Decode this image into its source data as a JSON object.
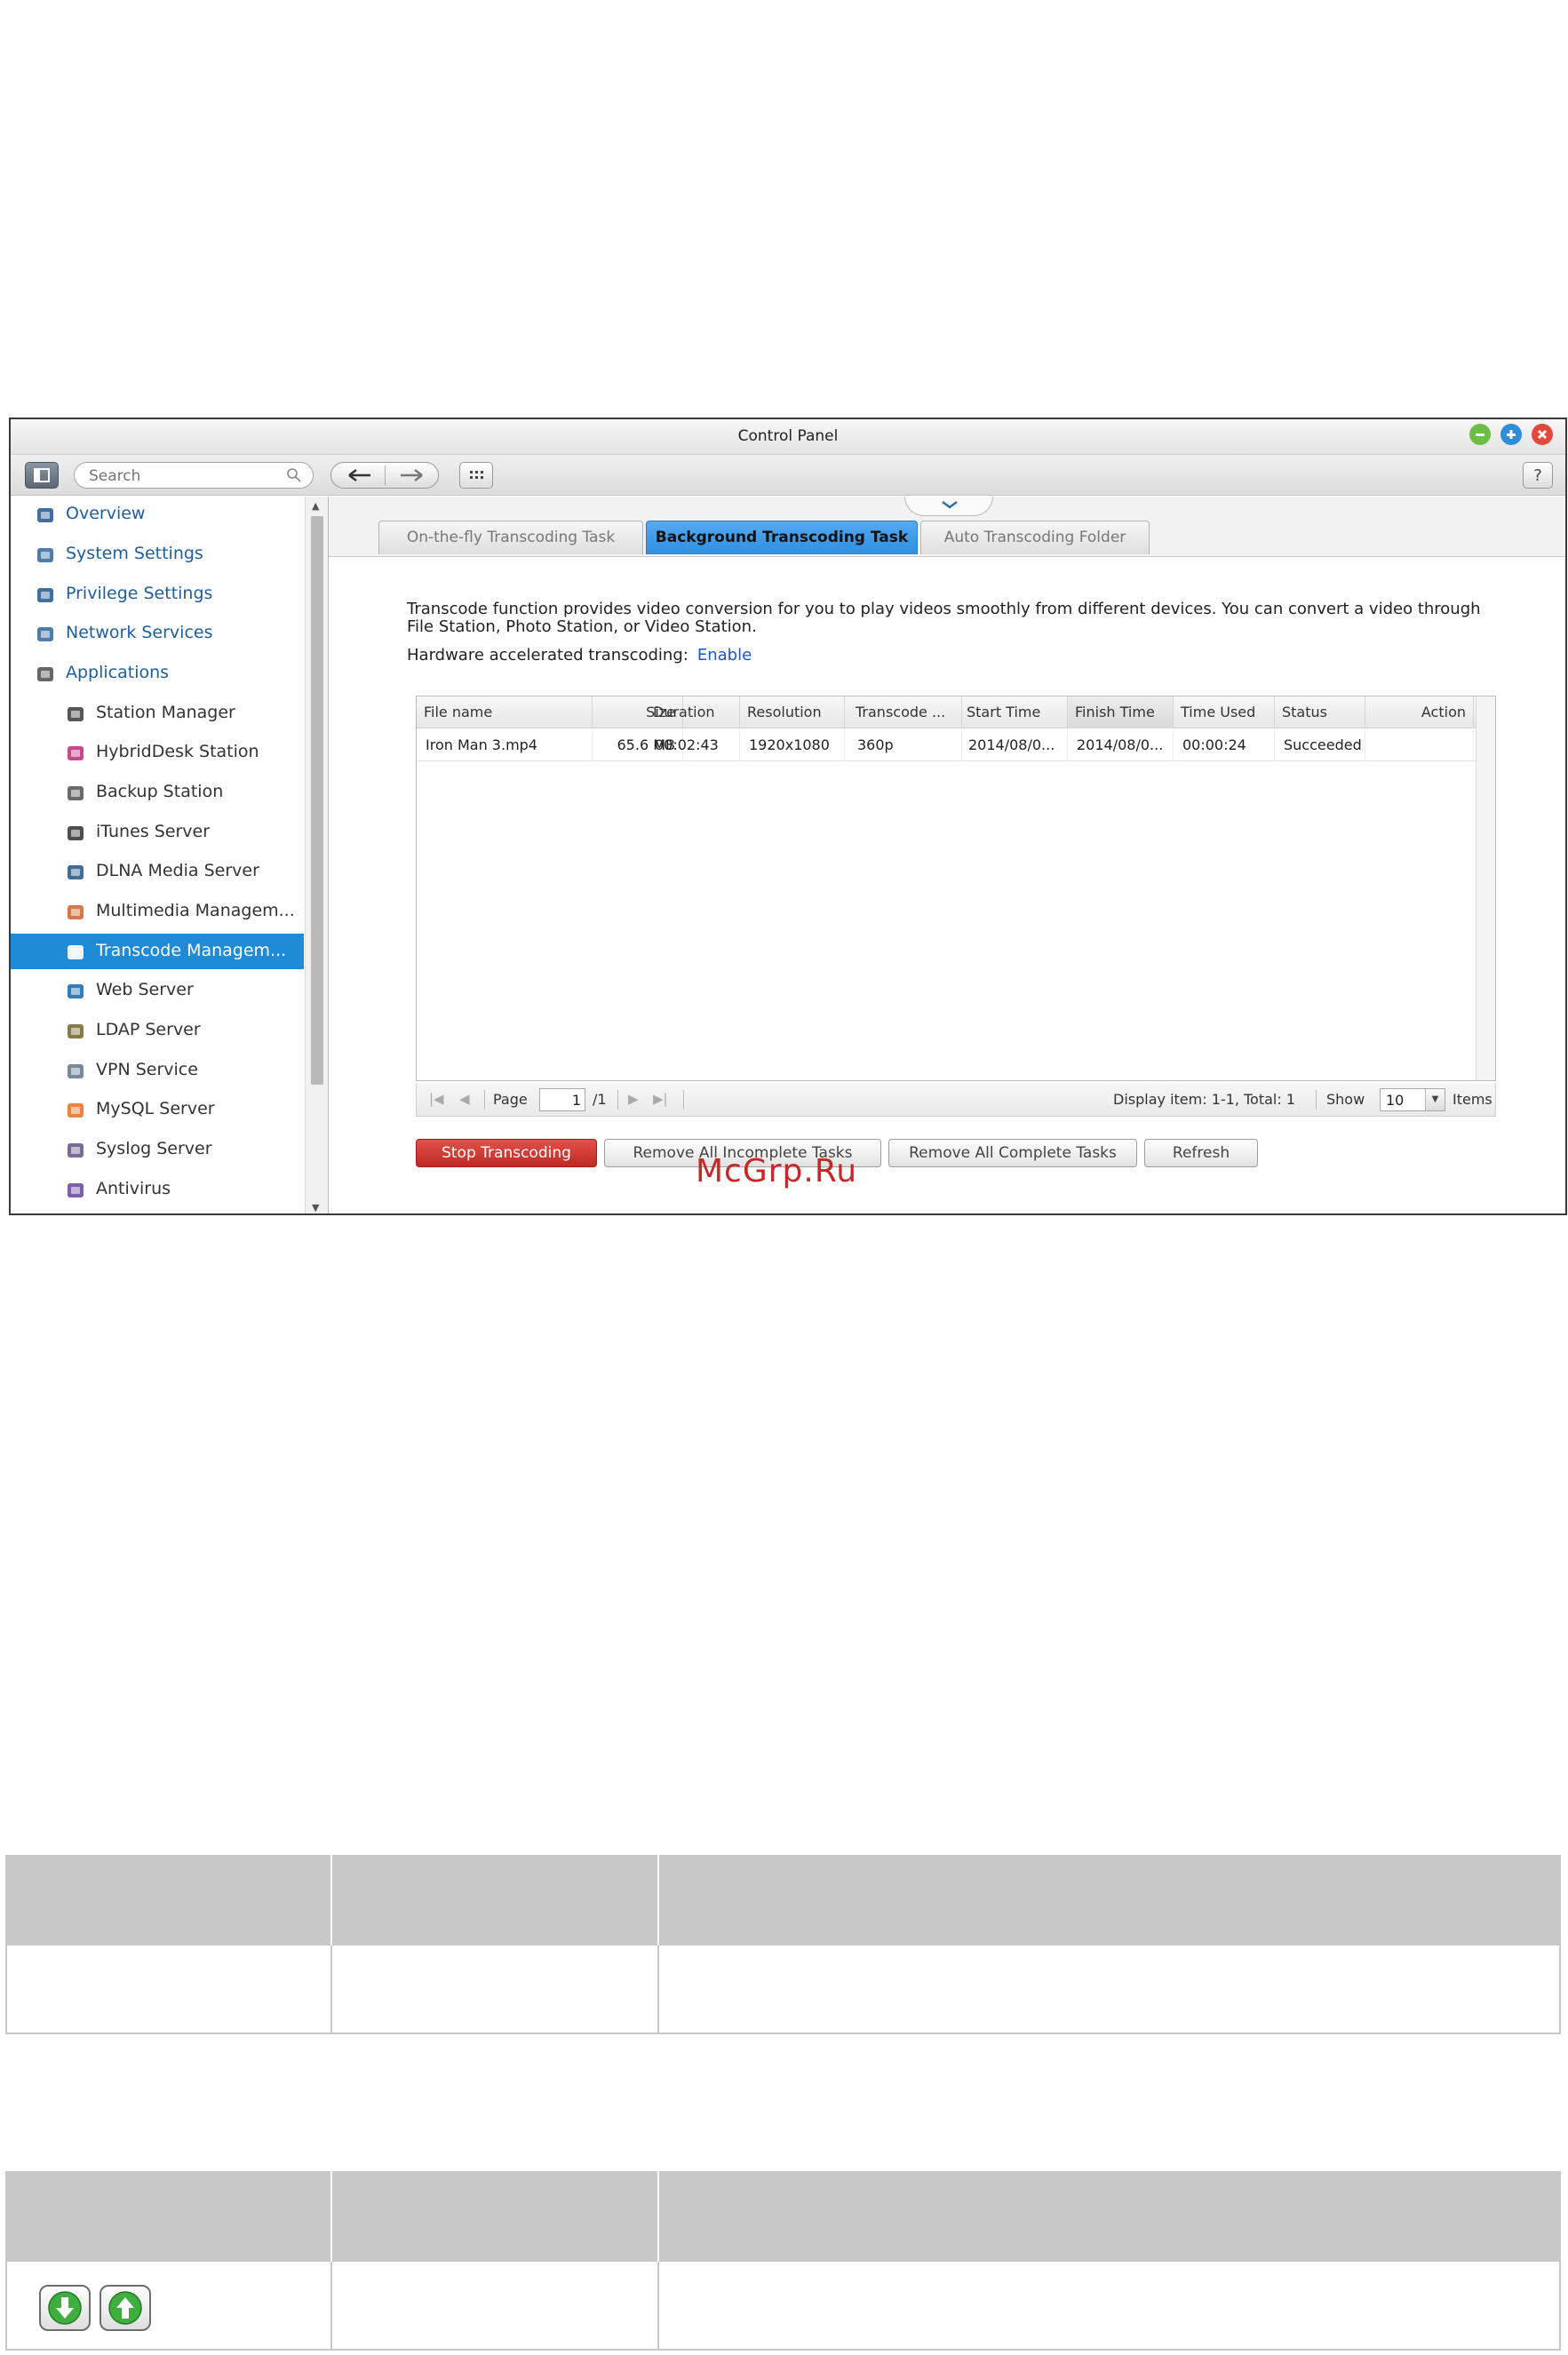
{
  "window": {
    "title": "Control Panel"
  },
  "toolbar": {
    "search_placeholder": "Search",
    "help_label": "?"
  },
  "sidebar": {
    "items": [
      {
        "label": "Overview",
        "icon": "overview-icon"
      },
      {
        "label": "System Settings",
        "icon": "gear-icon"
      },
      {
        "label": "Privilege Settings",
        "icon": "user-icon"
      },
      {
        "label": "Network Services",
        "icon": "globe-icon"
      },
      {
        "label": "Applications",
        "icon": "applications-icon"
      },
      {
        "label": "Station Manager",
        "icon": "station-manager-icon"
      },
      {
        "label": "HybridDesk Station",
        "icon": "hd-icon"
      },
      {
        "label": "Backup Station",
        "icon": "backup-icon"
      },
      {
        "label": "iTunes Server",
        "icon": "itunes-icon"
      },
      {
        "label": "DLNA Media Server",
        "icon": "dlna-icon"
      },
      {
        "label": "Multimedia Managem...",
        "icon": "multimedia-icon"
      },
      {
        "label": "Transcode Managem...",
        "icon": "transcode-icon"
      },
      {
        "label": "Web Server",
        "icon": "web-icon"
      },
      {
        "label": "LDAP Server",
        "icon": "ldap-icon"
      },
      {
        "label": "VPN Service",
        "icon": "vpn-icon"
      },
      {
        "label": "MySQL Server",
        "icon": "mysql-icon"
      },
      {
        "label": "Syslog Server",
        "icon": "syslog-icon"
      },
      {
        "label": "Antivirus",
        "icon": "antivirus-icon"
      }
    ],
    "active_index": 11
  },
  "tabs": [
    {
      "label": "On-the-fly Transcoding Task",
      "active": false
    },
    {
      "label": "Background Transcoding Task",
      "active": true
    },
    {
      "label": "Auto Transcoding Folder",
      "active": false
    }
  ],
  "content": {
    "description": "Transcode function provides video conversion for you to play videos smoothly from different devices. You can convert a video through File Station, Photo Station, or Video Station.",
    "hw_label": "Hardware accelerated transcoding:",
    "hw_link": "Enable"
  },
  "grid": {
    "columns": [
      "File name",
      "Size",
      "Duration",
      "Resolution",
      "Transcode ...",
      "Start Time",
      "Finish Time",
      "Time Used",
      "Status",
      "Action"
    ],
    "rows": [
      [
        "Iron Man 3.mp4",
        "65.6 MB",
        "00:02:43",
        "1920x1080",
        "360p",
        "2014/08/0...",
        "2014/08/0...",
        "00:00:24",
        "Succeeded",
        ""
      ]
    ]
  },
  "pager": {
    "page_label": "Page",
    "page_value": "1",
    "page_total": "/1",
    "display_text": "Display item: 1-1, Total: 1",
    "show_label": "Show",
    "show_value": "10",
    "items_label": "Items"
  },
  "buttons": {
    "stop": "Stop Transcoding",
    "remove_incomplete": "Remove All Incomplete Tasks",
    "remove_complete": "Remove All Complete Tasks",
    "refresh": "Refresh"
  },
  "watermark": "McGrp.Ru",
  "colors": {
    "accent": "#1f8bd6",
    "stop_button": "#c9342c",
    "link": "#1a56d6",
    "table_header": "#c8c8c8"
  }
}
